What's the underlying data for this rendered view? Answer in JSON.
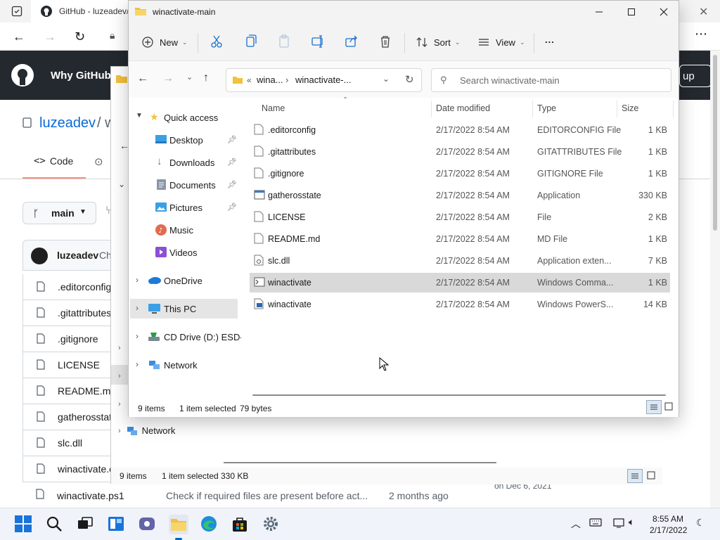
{
  "browser": {
    "tab_title": "GitHub - luzeadev/",
    "header_link": "Why GitHub",
    "signup": "up",
    "repo_owner": "luzeadev",
    "repo_slash": "/ w",
    "code_tab": "Code",
    "branch": "main",
    "commit_author": "luzeadev",
    "commit_trunc": "Ch",
    "files": [
      ".editorconfig",
      ".gitattributes",
      ".gitignore",
      "LICENSE",
      "README.md",
      "gatherosstate",
      "slc.dll",
      "winactivate.c"
    ],
    "last_file": "winactivate.ps1",
    "last_commit_msg": "Check if required files are present before act...",
    "last_age": "2 months ago",
    "updated": "on Dec 6, 2021"
  },
  "explorer_back": {
    "network": "Network",
    "status": {
      "items": "9 items",
      "selected": "1 item selected",
      "size": "330 KB"
    }
  },
  "explorer": {
    "title": "winactivate-main",
    "commands": {
      "new": "New",
      "sort": "Sort",
      "view": "View",
      "more": "..."
    },
    "address": {
      "prefix": "«",
      "seg1": "wina...",
      "sep": "›",
      "seg2": "winactivate-..."
    },
    "search_placeholder": "Search winactivate-main",
    "nav": {
      "quick_access": "Quick access",
      "desktop": "Desktop",
      "downloads": "Downloads",
      "documents": "Documents",
      "pictures": "Pictures",
      "music": "Music",
      "videos": "Videos",
      "onedrive": "OneDrive",
      "this_pc": "This PC",
      "cd_drive": "CD Drive (D:) ESD-IS",
      "network": "Network"
    },
    "columns": {
      "name": "Name",
      "date": "Date modified",
      "type": "Type",
      "size": "Size"
    },
    "files": [
      {
        "name": ".editorconfig",
        "date": "2/17/2022 8:54 AM",
        "type": "EDITORCONFIG File",
        "size": "1 KB",
        "icon": "file-icon"
      },
      {
        "name": ".gitattributes",
        "date": "2/17/2022 8:54 AM",
        "type": "GITATTRIBUTES File",
        "size": "1 KB",
        "icon": "file-icon"
      },
      {
        "name": ".gitignore",
        "date": "2/17/2022 8:54 AM",
        "type": "GITIGNORE File",
        "size": "1 KB",
        "icon": "file-icon"
      },
      {
        "name": "gatherosstate",
        "date": "2/17/2022 8:54 AM",
        "type": "Application",
        "size": "330 KB",
        "icon": "application-icon"
      },
      {
        "name": "LICENSE",
        "date": "2/17/2022 8:54 AM",
        "type": "File",
        "size": "2 KB",
        "icon": "file-icon"
      },
      {
        "name": "README.md",
        "date": "2/17/2022 8:54 AM",
        "type": "MD File",
        "size": "1 KB",
        "icon": "file-icon"
      },
      {
        "name": "slc.dll",
        "date": "2/17/2022 8:54 AM",
        "type": "Application exten...",
        "size": "7 KB",
        "icon": "dll-icon"
      },
      {
        "name": "winactivate",
        "date": "2/17/2022 8:54 AM",
        "type": "Windows Comma...",
        "size": "1 KB",
        "icon": "cmd-script-icon",
        "selected": true
      },
      {
        "name": "winactivate",
        "date": "2/17/2022 8:54 AM",
        "type": "Windows PowerS...",
        "size": "14 KB",
        "icon": "powershell-script-icon"
      }
    ],
    "status": {
      "items": "9 items",
      "selected": "1 item selected",
      "size": "79 bytes"
    }
  },
  "taskbar": {
    "time": "8:55 AM",
    "date": "2/17/2022"
  },
  "colors": {
    "accent": "#0067c0",
    "folder": "#f3c13a",
    "github_header": "#24292f",
    "selection": "#d9d9d9"
  }
}
